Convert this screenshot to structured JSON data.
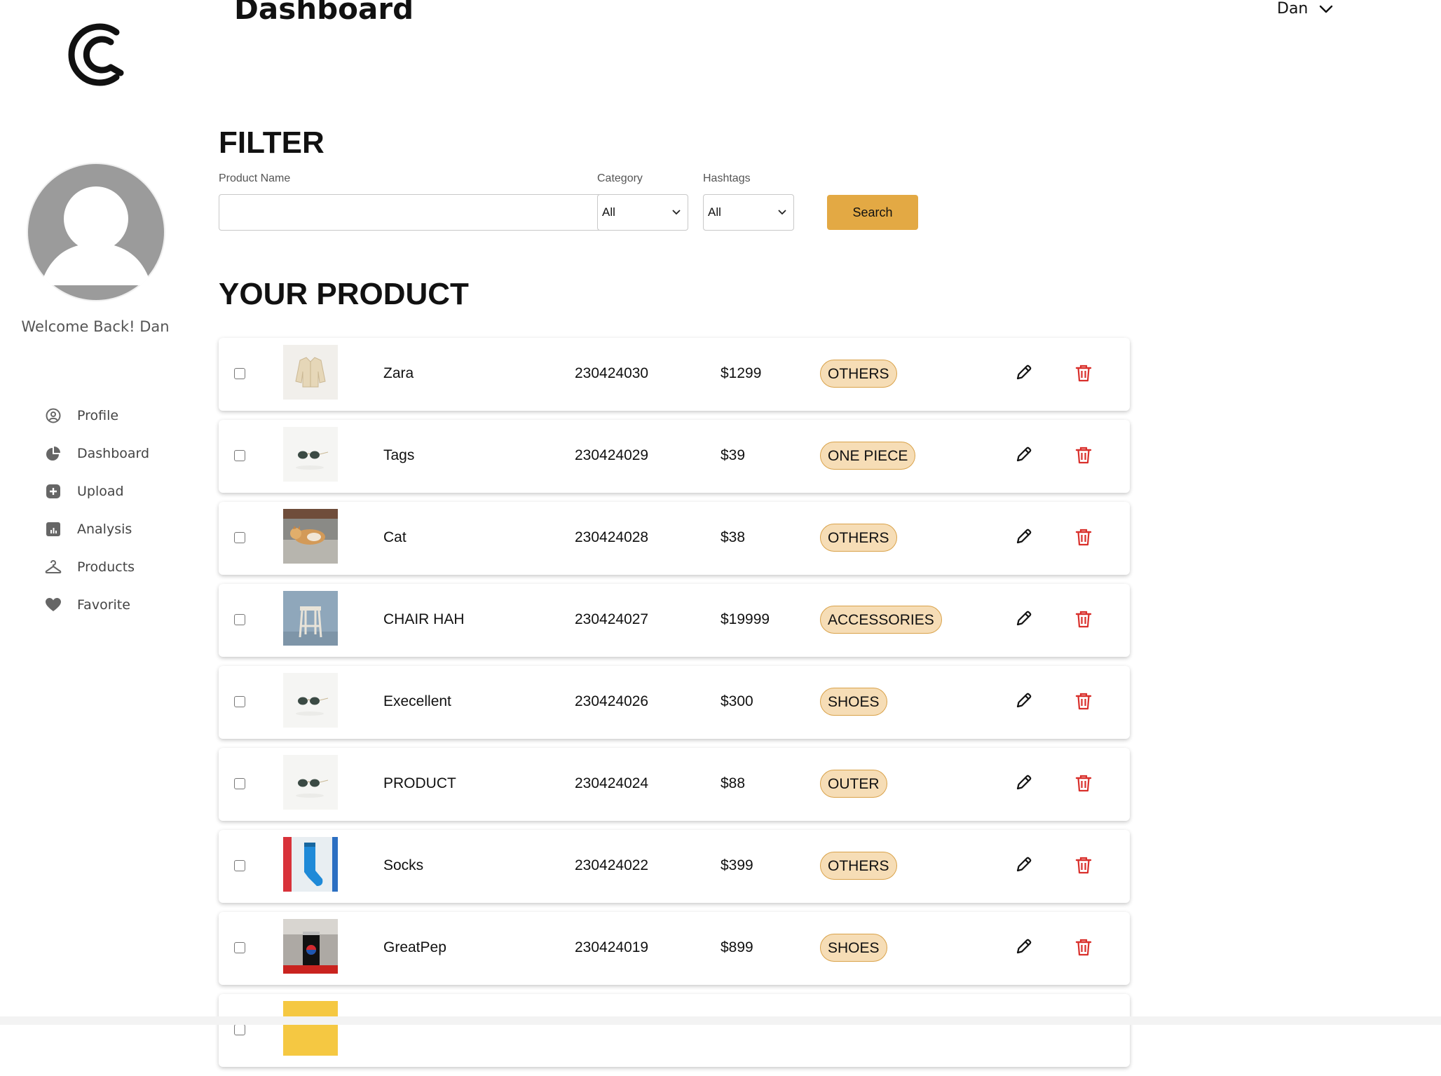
{
  "header": {
    "title": "Dashboard",
    "user_name": "Dan"
  },
  "sidebar": {
    "welcome": "Welcome Back! Dan",
    "items": [
      {
        "label": "Profile",
        "icon": "user-circle-icon"
      },
      {
        "label": "Dashboard",
        "icon": "pie-chart-icon"
      },
      {
        "label": "Upload",
        "icon": "plus-square-icon"
      },
      {
        "label": "Analysis",
        "icon": "bar-chart-icon"
      },
      {
        "label": "Products",
        "icon": "hanger-icon"
      },
      {
        "label": "Favorite",
        "icon": "heart-icon"
      }
    ]
  },
  "filter": {
    "title": "FILTER",
    "product_name_label": "Product Name",
    "product_name_value": "",
    "category_label": "Category",
    "category_value": "All",
    "hashtags_label": "Hashtags",
    "hashtags_value": "All",
    "search_label": "Search"
  },
  "products": {
    "title": "YOUR PRODUCT",
    "rows": [
      {
        "name": "Zara",
        "id": "230424030",
        "price": "$1299",
        "tag": "OTHERS",
        "thumb": "jacket"
      },
      {
        "name": "Tags",
        "id": "230424029",
        "price": "$39",
        "tag": "ONE PIECE",
        "thumb": "glasses"
      },
      {
        "name": "Cat",
        "id": "230424028",
        "price": "$38",
        "tag": "OTHERS",
        "thumb": "cat"
      },
      {
        "name": "CHAIR HAH",
        "id": "230424027",
        "price": "$19999",
        "tag": "ACCESSORIES",
        "thumb": "stool"
      },
      {
        "name": "Execellent",
        "id": "230424026",
        "price": "$300",
        "tag": "SHOES",
        "thumb": "glasses"
      },
      {
        "name": "PRODUCT",
        "id": "230424024",
        "price": "$88",
        "tag": "OUTER",
        "thumb": "glasses"
      },
      {
        "name": "Socks",
        "id": "230424022",
        "price": "$399",
        "tag": "OTHERS",
        "thumb": "socks"
      },
      {
        "name": "GreatPep",
        "id": "230424019",
        "price": "$899",
        "tag": "SHOES",
        "thumb": "can"
      },
      {
        "name": "",
        "id": "",
        "price": "",
        "tag": "",
        "thumb": "yellow"
      }
    ]
  },
  "colors": {
    "accent": "#e3a944",
    "badge_bg": "#f6ddb6",
    "badge_border": "#d9a24a",
    "delete": "#d9302c"
  }
}
